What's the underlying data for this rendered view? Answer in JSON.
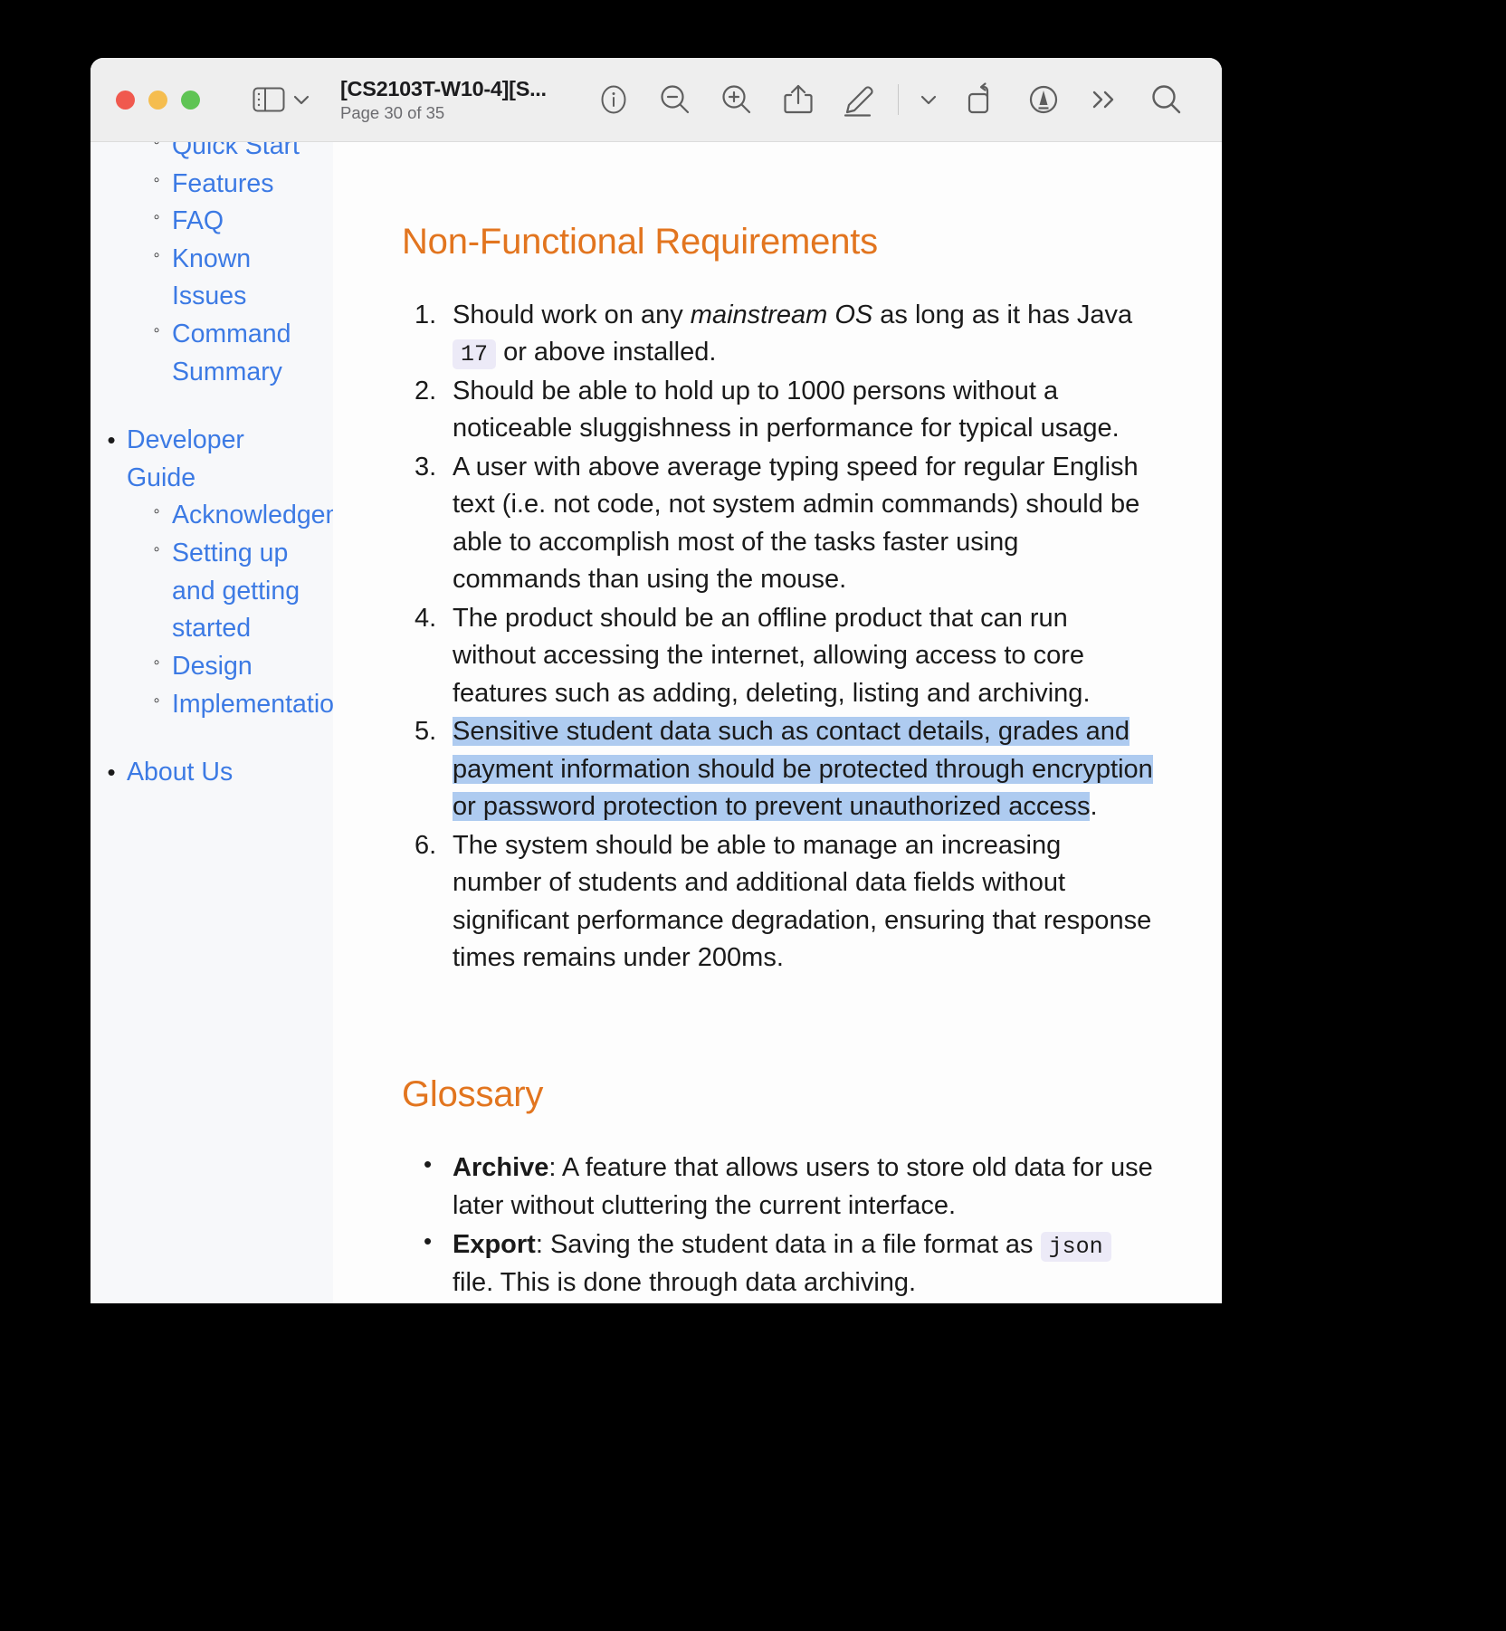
{
  "window": {
    "traffic_lights": [
      "close",
      "minimize",
      "zoom"
    ],
    "colors": {
      "close": "#f0594e",
      "minimize": "#f5bd4f",
      "zoom": "#5fc454",
      "heading": "#e2751f",
      "link": "#3c7ae4",
      "highlight": "#aecbf0",
      "code_bg": "#eceaf7",
      "toolbar_bg": "#eeeeee"
    }
  },
  "toolbar": {
    "doc_title": "[CS2103T-W10-4][S...",
    "page_indicator": "Page 30 of 35",
    "sidebar_toggle": "sidebar-icon",
    "sidebar_chevron": "chevron-down-icon",
    "icons": [
      {
        "name": "info-icon",
        "label": "Info"
      },
      {
        "name": "zoom-out-icon",
        "label": "Zoom Out"
      },
      {
        "name": "zoom-in-icon",
        "label": "Zoom In"
      },
      {
        "name": "share-icon",
        "label": "Share"
      },
      {
        "name": "markup-pen-icon",
        "label": "Markup"
      },
      {
        "name": "chevron-down-icon",
        "label": "Markup Options"
      },
      {
        "name": "rotate-icon",
        "label": "Rotate"
      },
      {
        "name": "annotate-circle-icon",
        "label": "Annotate"
      },
      {
        "name": "more-chevrons-icon",
        "label": "More"
      },
      {
        "name": "search-icon",
        "label": "Search"
      }
    ]
  },
  "sidebar": {
    "items": [
      {
        "label": "Quick Start",
        "level": 2
      },
      {
        "label": "Features",
        "level": 2
      },
      {
        "label": "FAQ",
        "level": 2
      },
      {
        "label": "Known Issues",
        "level": 2
      },
      {
        "label": "Command Summary",
        "level": 2
      },
      {
        "label": "Developer Guide",
        "level": 1
      },
      {
        "label": "Acknowledgements",
        "level": 2
      },
      {
        "label": "Setting up and getting started",
        "level": 2
      },
      {
        "label": "Design",
        "level": 2
      },
      {
        "label": "Implementation",
        "level": 2
      },
      {
        "label": "About Us",
        "level": 1
      }
    ]
  },
  "document": {
    "sections": {
      "nfr_heading": "Non-Functional Requirements",
      "glossary_heading": "Glossary"
    },
    "requirements": {
      "r1_a": "Should work on any ",
      "r1_em": "mainstream OS",
      "r1_b": " as long as it has Java ",
      "r1_code": "17",
      "r1_c": " or above installed.",
      "r2": "Should be able to hold up to 1000 persons without a noticeable sluggishness in performance for typical usage.",
      "r3": "A user with above average typing speed for regular English text (i.e. not code, not system admin commands) should be able to accomplish most of the tasks faster using commands than using the mouse.",
      "r4": "The product should be an offline product that can run without accessing the internet, allowing access to core features such as adding, deleting, listing and archiving.",
      "r5": "Sensitive student data such as contact details, grades and payment information should be protected through encryption or password protection to prevent unauthorized access",
      "r5_period": ".",
      "r6": "The system should be able to manage an increasing number of students and additional data fields without significant performance degradation, ensuring that response times remains under 200ms."
    },
    "glossary": {
      "g1_term": "Archive",
      "g1_text": ": A feature that allows users to store old data for use later without cluttering the current interface.",
      "g2_term": "Export",
      "g2_text_a": ": Saving the student data in a file format as ",
      "g2_code": "json",
      "g2_text_b": " file. This is done through data archiving."
    }
  }
}
